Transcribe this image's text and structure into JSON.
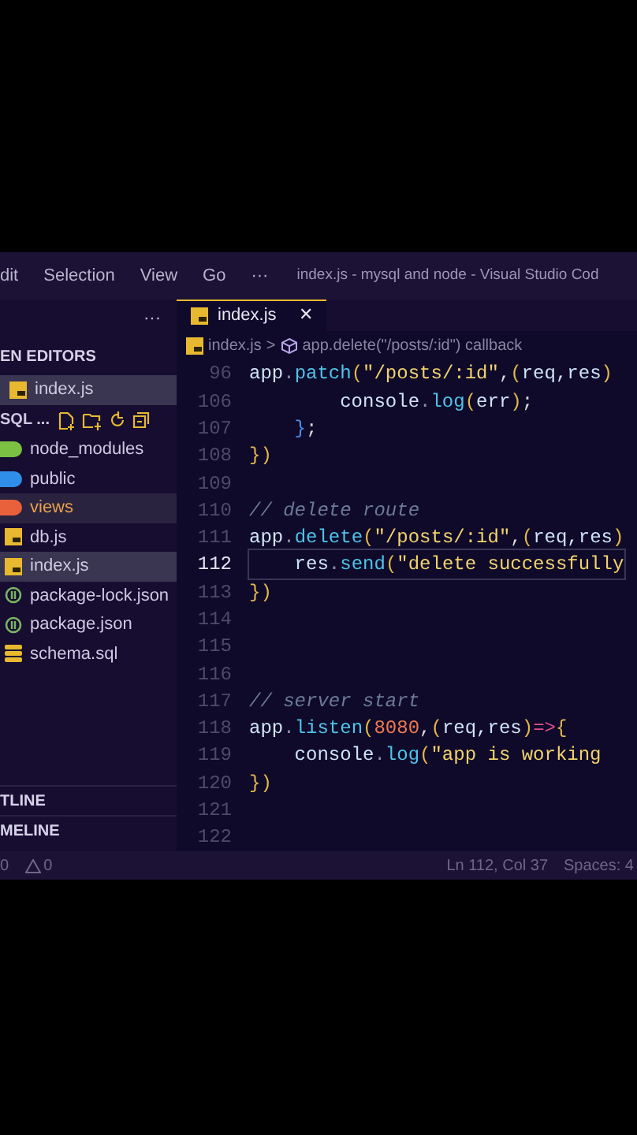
{
  "menu": [
    "dit",
    "Selection",
    "View",
    "Go",
    "···"
  ],
  "window": {
    "title": "index.js - mysql and node - Visual Studio Cod"
  },
  "sidebar": {
    "more": "···",
    "open_editors": {
      "title": "EN EDITORS",
      "items": [
        {
          "name": "index.js",
          "kind": "js",
          "selected": true
        }
      ]
    },
    "folder": {
      "title": "SQL ...",
      "items": [
        {
          "name": "node_modules",
          "kind": "folder",
          "color": "#7bc043",
          "selected": false,
          "modified": false
        },
        {
          "name": "public",
          "kind": "folder",
          "color": "#2f8fe8",
          "selected": false,
          "modified": false
        },
        {
          "name": "views",
          "kind": "folder",
          "color": "#e8613a",
          "selected": false,
          "modified": true
        },
        {
          "name": "db.js",
          "kind": "js",
          "selected": false,
          "modified": false
        },
        {
          "name": "index.js",
          "kind": "js",
          "selected": true,
          "modified": false
        },
        {
          "name": "package-lock.json",
          "kind": "json",
          "selected": false,
          "modified": false
        },
        {
          "name": "package.json",
          "kind": "json",
          "selected": false,
          "modified": false
        },
        {
          "name": "schema.sql",
          "kind": "db",
          "selected": false,
          "modified": false
        }
      ]
    },
    "sections": [
      "TLINE",
      "MELINE"
    ]
  },
  "tabs": [
    {
      "label": "index.js",
      "close": "✕",
      "selected": true
    }
  ],
  "breadcrumb": {
    "file": "index.js",
    "separator": ">",
    "symbol": "app.delete(\"/posts/:id\") callback"
  },
  "code": [
    {
      "number": "96",
      "current": false,
      "tokens": [
        {
          "kind": "var",
          "t": "app"
        },
        {
          "kind": "dot",
          "t": "."
        },
        {
          "kind": "fn",
          "t": "patch"
        },
        {
          "kind": "paren",
          "t": "("
        },
        {
          "kind": "str",
          "t": "\"/posts/:id\""
        },
        {
          "kind": "punct",
          "t": ","
        },
        {
          "kind": "paren",
          "t": "("
        },
        {
          "kind": "var",
          "t": "req,res"
        },
        {
          "kind": "paren",
          "t": ")"
        }
      ]
    },
    {
      "number": "106",
      "current": false,
      "tokens": [
        {
          "kind": "var",
          "t": "        console"
        },
        {
          "kind": "dot",
          "t": "."
        },
        {
          "kind": "fn",
          "t": "log"
        },
        {
          "kind": "paren",
          "t": "("
        },
        {
          "kind": "var",
          "t": "err"
        },
        {
          "kind": "paren",
          "t": ")"
        },
        {
          "kind": "punct",
          "t": ";"
        }
      ]
    },
    {
      "number": "107",
      "current": false,
      "tokens": [
        {
          "kind": "brace",
          "t": "    }"
        },
        {
          "kind": "punct",
          "t": ";"
        }
      ]
    },
    {
      "number": "108",
      "current": false,
      "tokens": [
        {
          "kind": "paren",
          "t": "})"
        }
      ]
    },
    {
      "number": "109",
      "current": false
    },
    {
      "number": "110",
      "current": false,
      "tokens": [
        {
          "kind": "comment",
          "t": "// delete route"
        }
      ]
    },
    {
      "number": "111",
      "current": false,
      "tokens": [
        {
          "kind": "var",
          "t": "app"
        },
        {
          "kind": "dot",
          "t": "."
        },
        {
          "kind": "fn",
          "t": "delete"
        },
        {
          "kind": "paren",
          "t": "("
        },
        {
          "kind": "str",
          "t": "\"/posts/:id\""
        },
        {
          "kind": "punct",
          "t": ","
        },
        {
          "kind": "paren",
          "t": "("
        },
        {
          "kind": "var",
          "t": "req,res"
        },
        {
          "kind": "paren",
          "t": ")"
        }
      ]
    },
    {
      "number": "112",
      "current": true,
      "tokens": [
        {
          "kind": "var",
          "t": "    res"
        },
        {
          "kind": "dot",
          "t": "."
        },
        {
          "kind": "fn",
          "t": "send"
        },
        {
          "kind": "paren",
          "t": "("
        },
        {
          "kind": "str",
          "t": "\"delete successfully"
        }
      ]
    },
    {
      "number": "113",
      "current": false,
      "tokens": [
        {
          "kind": "paren",
          "t": "})"
        }
      ]
    },
    {
      "number": "114",
      "current": false
    },
    {
      "number": "115",
      "current": false
    },
    {
      "number": "116",
      "current": false
    },
    {
      "number": "117",
      "current": false,
      "tokens": [
        {
          "kind": "comment",
          "t": "// server start"
        }
      ]
    },
    {
      "number": "118",
      "current": false,
      "tokens": [
        {
          "kind": "var",
          "t": "app"
        },
        {
          "kind": "dot",
          "t": "."
        },
        {
          "kind": "fn",
          "t": "listen"
        },
        {
          "kind": "paren",
          "t": "("
        },
        {
          "kind": "num",
          "t": "8080"
        },
        {
          "kind": "punct",
          "t": ","
        },
        {
          "kind": "paren",
          "t": "("
        },
        {
          "kind": "var",
          "t": "req,res"
        },
        {
          "kind": "paren",
          "t": ")"
        },
        {
          "kind": "op",
          "t": "=>"
        },
        {
          "kind": "paren",
          "t": "{"
        }
      ]
    },
    {
      "number": "119",
      "current": false,
      "tokens": [
        {
          "kind": "var",
          "t": "    console"
        },
        {
          "kind": "dot",
          "t": "."
        },
        {
          "kind": "fn",
          "t": "log"
        },
        {
          "kind": "paren",
          "t": "("
        },
        {
          "kind": "str",
          "t": "\"app is working"
        }
      ]
    },
    {
      "number": "120",
      "current": false,
      "tokens": [
        {
          "kind": "paren",
          "t": "})"
        }
      ]
    },
    {
      "number": "121",
      "current": false
    },
    {
      "number": "122",
      "current": false
    }
  ],
  "status_bar": {
    "errors": "0",
    "warnings": "0",
    "position": "Ln 112, Col 37",
    "spaces": "Spaces: 4"
  }
}
